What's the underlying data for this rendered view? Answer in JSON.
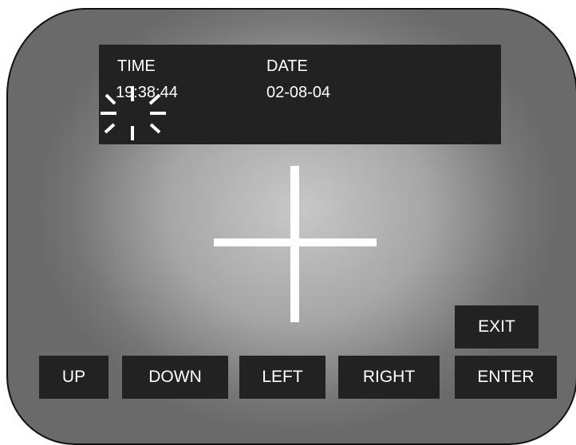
{
  "display": {
    "time_label": "TIME",
    "time_value": "19:38:44",
    "date_label": "DATE",
    "date_value": "02-08-04"
  },
  "buttons": {
    "up": "UP",
    "down": "DOWN",
    "left": "LEFT",
    "right": "RIGHT",
    "enter": "ENTER",
    "exit": "EXIT"
  },
  "icons": {
    "spinner": "loading-spinner-icon",
    "crosshair": "crosshair-icon"
  },
  "colors": {
    "panel": "#222222",
    "text": "#ffffff",
    "screen_center": "#c8c8c8",
    "screen_edge": "#6a6a6a"
  }
}
